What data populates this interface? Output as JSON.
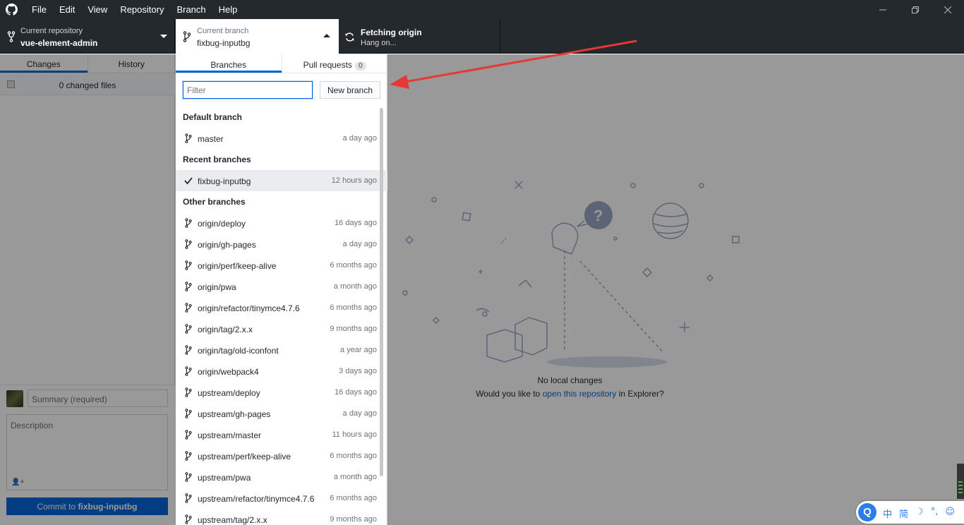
{
  "menu": [
    "File",
    "Edit",
    "View",
    "Repository",
    "Branch",
    "Help"
  ],
  "toolbar": {
    "repo_label": "Current repository",
    "repo_name": "vue-element-admin",
    "branch_label": "Current branch",
    "branch_name": "fixbug-inputbg",
    "fetch_title": "Fetching origin",
    "fetch_sub": "Hang on..."
  },
  "left": {
    "tab_changes": "Changes",
    "tab_history": "History",
    "changed_files": "0 changed files",
    "summary_placeholder": "Summary (required)",
    "description_placeholder": "Description",
    "commit_prefix": "Commit to ",
    "commit_branch": "fixbug-inputbg"
  },
  "main": {
    "no_changes": "No local changes",
    "question_pre": "Would you like to ",
    "question_link": "open this repository",
    "question_post": " in Explorer?"
  },
  "dropdown": {
    "tab_branches": "Branches",
    "tab_pulls": "Pull requests",
    "pull_count": "0",
    "filter_placeholder": "Filter",
    "new_branch": "New branch",
    "sections": {
      "default": "Default branch",
      "recent": "Recent branches",
      "other": "Other branches"
    },
    "default_branch": {
      "name": "master",
      "time": "a day ago"
    },
    "recent_branch": {
      "name": "fixbug-inputbg",
      "time": "12 hours ago"
    },
    "other_branches": [
      {
        "name": "origin/deploy",
        "time": "16 days ago"
      },
      {
        "name": "origin/gh-pages",
        "time": "a day ago"
      },
      {
        "name": "origin/perf/keep-alive",
        "time": "6 months ago"
      },
      {
        "name": "origin/pwa",
        "time": "a month ago"
      },
      {
        "name": "origin/refactor/tinymce4.7.6",
        "time": "6 months ago"
      },
      {
        "name": "origin/tag/2.x.x",
        "time": "9 months ago"
      },
      {
        "name": "origin/tag/old-iconfont",
        "time": "a year ago"
      },
      {
        "name": "origin/webpack4",
        "time": "3 days ago"
      },
      {
        "name": "upstream/deploy",
        "time": "16 days ago"
      },
      {
        "name": "upstream/gh-pages",
        "time": "a day ago"
      },
      {
        "name": "upstream/master",
        "time": "11 hours ago"
      },
      {
        "name": "upstream/perf/keep-alive",
        "time": "6 months ago"
      },
      {
        "name": "upstream/pwa",
        "time": "a month ago"
      },
      {
        "name": "upstream/refactor/tinymce4.7.6",
        "time": "6 months ago"
      },
      {
        "name": "upstream/tag/2.x.x",
        "time": "9 months ago"
      }
    ]
  },
  "ime": {
    "logo": "Q",
    "items": [
      "中",
      "简",
      "☽",
      "°,",
      "☺"
    ]
  },
  "colors": {
    "accent": "#0366d6",
    "dark": "#24292e",
    "annotation": "#e53935"
  }
}
